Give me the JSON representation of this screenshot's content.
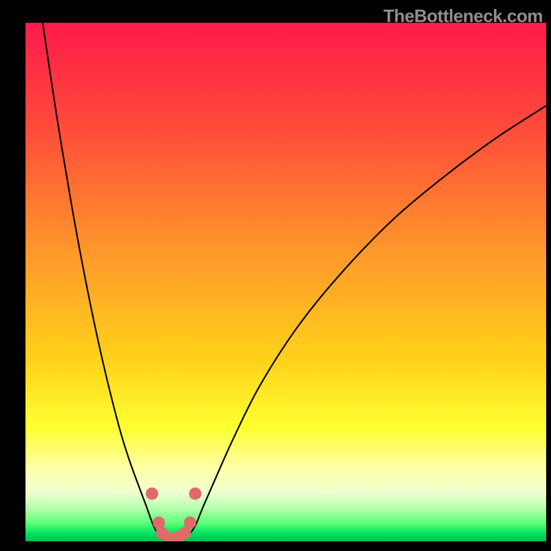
{
  "watermark": "TheBottleneck.com",
  "chart_data": {
    "type": "line",
    "title": "",
    "xlabel": "",
    "ylabel": "",
    "xlim": [
      0,
      100
    ],
    "ylim": [
      0,
      100
    ],
    "gradient_stops": [
      {
        "offset": 0.0,
        "color": "#ff1a4a"
      },
      {
        "offset": 0.2,
        "color": "#ff4a3a"
      },
      {
        "offset": 0.45,
        "color": "#ff9a2a"
      },
      {
        "offset": 0.65,
        "color": "#ffd21a"
      },
      {
        "offset": 0.78,
        "color": "#ffff30"
      },
      {
        "offset": 0.86,
        "color": "#ffffa8"
      },
      {
        "offset": 0.905,
        "color": "#f0ffd0"
      },
      {
        "offset": 0.935,
        "color": "#b8ffb0"
      },
      {
        "offset": 0.965,
        "color": "#5cff78"
      },
      {
        "offset": 0.985,
        "color": "#00e060"
      },
      {
        "offset": 1.0,
        "color": "#00c050"
      }
    ],
    "series": [
      {
        "name": "bottleneck-curve",
        "type": "line",
        "color": "#000000",
        "points": [
          {
            "x": 3.3,
            "y": 100.0
          },
          {
            "x": 6.0,
            "y": 82.0
          },
          {
            "x": 9.0,
            "y": 64.0
          },
          {
            "x": 12.0,
            "y": 48.0
          },
          {
            "x": 15.0,
            "y": 34.0
          },
          {
            "x": 18.0,
            "y": 22.0
          },
          {
            "x": 20.0,
            "y": 15.5
          },
          {
            "x": 22.0,
            "y": 10.0
          },
          {
            "x": 23.2,
            "y": 6.8
          },
          {
            "x": 24.5,
            "y": 3.2
          },
          {
            "x": 25.5,
            "y": 1.4
          },
          {
            "x": 26.5,
            "y": 0.6
          },
          {
            "x": 27.8,
            "y": 0.3
          },
          {
            "x": 29.2,
            "y": 0.3
          },
          {
            "x": 30.5,
            "y": 0.6
          },
          {
            "x": 31.5,
            "y": 1.4
          },
          {
            "x": 32.7,
            "y": 3.2
          },
          {
            "x": 34.0,
            "y": 6.4
          },
          {
            "x": 36.0,
            "y": 11.0
          },
          {
            "x": 40.0,
            "y": 20.0
          },
          {
            "x": 45.0,
            "y": 30.0
          },
          {
            "x": 52.0,
            "y": 41.0
          },
          {
            "x": 60.0,
            "y": 51.0
          },
          {
            "x": 70.0,
            "y": 61.5
          },
          {
            "x": 80.0,
            "y": 70.0
          },
          {
            "x": 90.0,
            "y": 77.5
          },
          {
            "x": 100.0,
            "y": 84.0
          }
        ]
      }
    ],
    "markers": [
      {
        "x": 24.3,
        "y": 9.2
      },
      {
        "x": 25.6,
        "y": 3.6
      },
      {
        "x": 26.2,
        "y": 1.6
      },
      {
        "x": 27.5,
        "y": 0.7
      },
      {
        "x": 29.3,
        "y": 0.7
      },
      {
        "x": 30.6,
        "y": 1.6
      },
      {
        "x": 31.6,
        "y": 3.6
      },
      {
        "x": 32.6,
        "y": 9.2
      }
    ],
    "marker_style": {
      "color": "#e06a6a",
      "radius": 9
    }
  }
}
